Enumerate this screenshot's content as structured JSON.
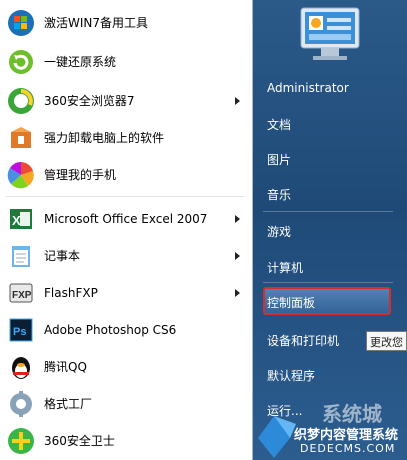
{
  "left_menu": {
    "items": [
      {
        "label": "激活WIN7备用工具",
        "icon": "win7-orb-icon"
      },
      {
        "label": "一键还原系统",
        "icon": "restore-icon"
      },
      {
        "label": "360安全浏览器7",
        "icon": "360-browser-icon",
        "submenu": true
      },
      {
        "label": "强力卸载电脑上的软件",
        "icon": "uninstall-box-icon"
      },
      {
        "label": "管理我的手机",
        "icon": "phone-manager-icon"
      },
      {
        "label": "Microsoft Office Excel 2007",
        "icon": "excel-icon",
        "submenu": true
      },
      {
        "label": "记事本",
        "icon": "notepad-icon",
        "submenu": true
      },
      {
        "label": "FlashFXP",
        "icon": "flashfxp-icon",
        "submenu": true
      },
      {
        "label": "Adobe Photoshop CS6",
        "icon": "photoshop-icon"
      },
      {
        "label": "腾讯QQ",
        "icon": "qq-penguin-icon"
      },
      {
        "label": "格式工厂",
        "icon": "format-factory-icon"
      },
      {
        "label": "360安全卫士",
        "icon": "360-safe-icon"
      }
    ]
  },
  "right_menu": {
    "user_icon": "control-panel-monitor-icon",
    "items": [
      {
        "label": "Administrator"
      },
      {
        "label": "文档"
      },
      {
        "label": "图片"
      },
      {
        "label": "音乐"
      },
      {
        "label": "游戏"
      },
      {
        "label": "计算机"
      },
      {
        "label": "控制面板"
      },
      {
        "label": "设备和打印机"
      },
      {
        "label": "默认程序"
      },
      {
        "label": "运行..."
      }
    ],
    "highlight_color": "#d92d2d"
  },
  "tooltip": {
    "text": "更改您"
  },
  "watermark": {
    "site": "系统城",
    "text": "织梦内容管理系统",
    "url": "DEDECMS.COM"
  }
}
